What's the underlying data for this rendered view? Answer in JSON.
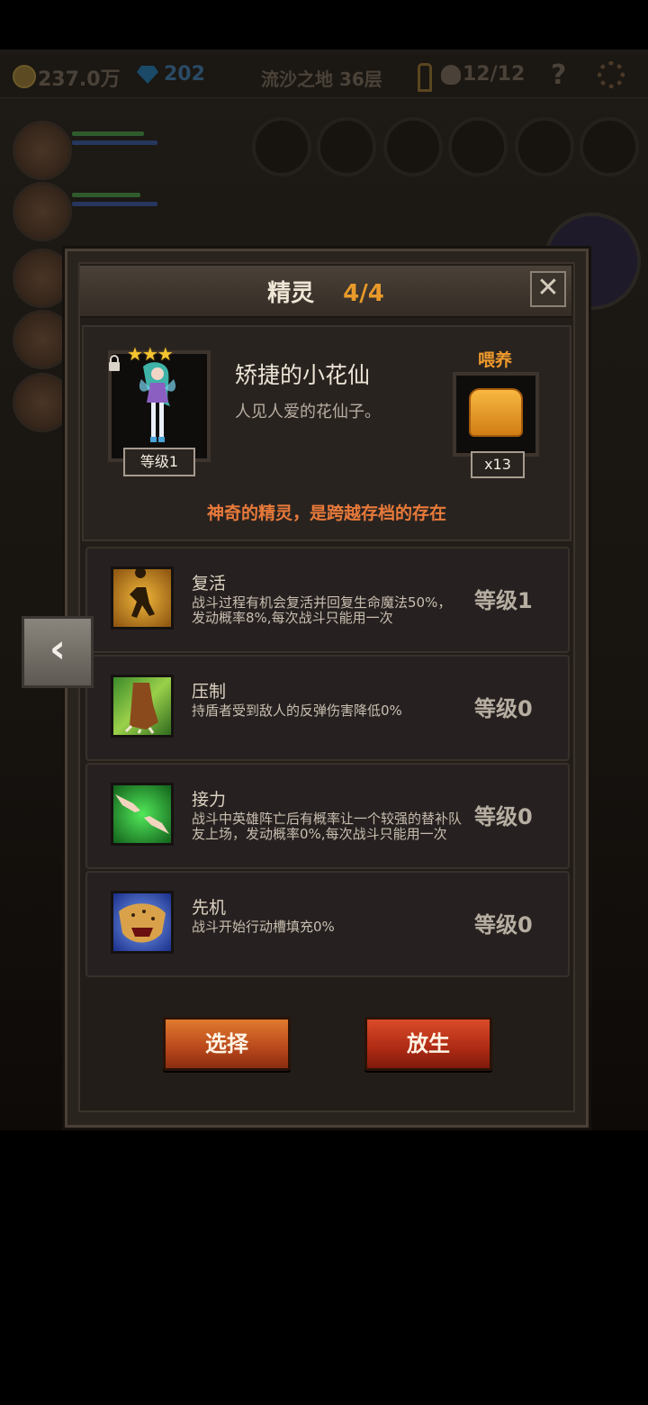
{
  "topbar": {
    "gold": "237.0万",
    "gems": "202",
    "location": "流沙之地 36层",
    "keys": "12/12",
    "help": "?"
  },
  "panel": {
    "title": "精灵",
    "count": "4/4",
    "close": "✕"
  },
  "pet": {
    "stars": "★★★",
    "name": "矫捷的小花仙",
    "description": "人见人爱的花仙子。",
    "level_badge": "等级1",
    "feed_label": "喂养",
    "feed_count": "x13",
    "tagline": "神奇的精灵，是跨越存档的存在"
  },
  "skills": [
    {
      "name": "复活",
      "desc": "战斗过程有机会复活并回复生命魔法50%，发动概率8%,每次战斗只能用一次",
      "level": "等级1",
      "icon": "revive-silhouette-icon"
    },
    {
      "name": "压制",
      "desc": "持盾者受到敌人的反弹伤害降低0%",
      "level": "等级0",
      "icon": "beast-claw-icon"
    },
    {
      "name": "接力",
      "desc": "战斗中英雄阵亡后有概率让一个较强的替补队友上场，发动概率0%,每次战斗只能用一次",
      "level": "等级0",
      "icon": "hands-relay-icon"
    },
    {
      "name": "先机",
      "desc": "战斗开始行动槽填充0%",
      "level": "等级0",
      "icon": "leopard-icon"
    }
  ],
  "buttons": {
    "select": "选择",
    "release": "放生",
    "back": "‹"
  }
}
